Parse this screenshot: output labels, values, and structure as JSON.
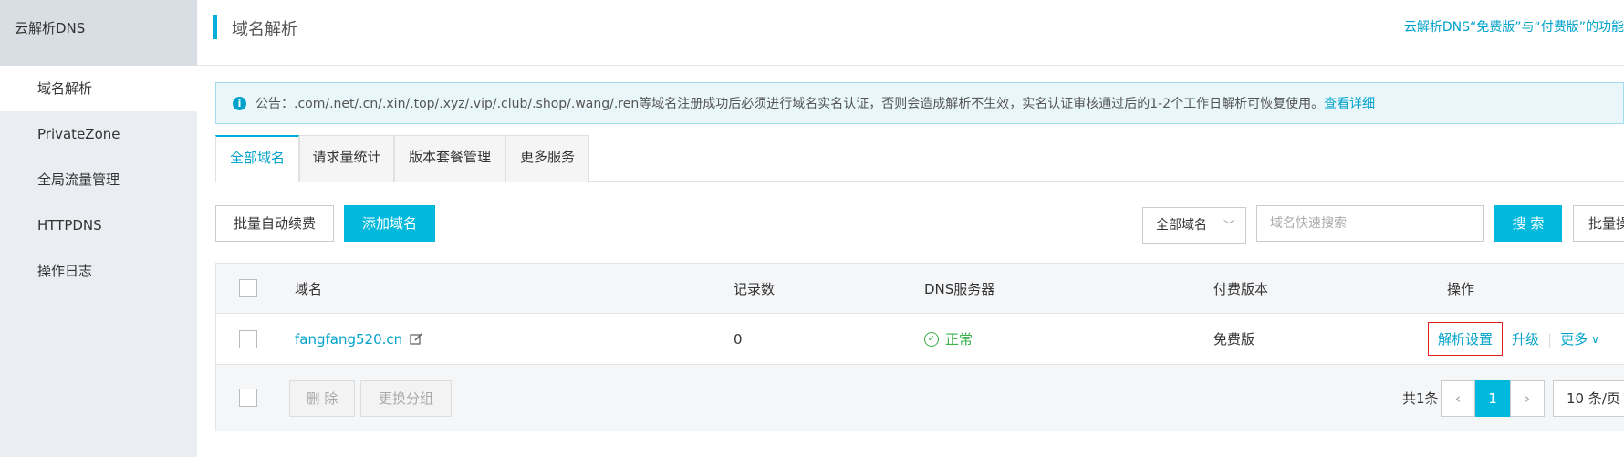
{
  "sidebar": {
    "title": "云解析DNS",
    "items": [
      {
        "label": "域名解析"
      },
      {
        "label": "PrivateZone"
      },
      {
        "label": "全局流量管理"
      },
      {
        "label": "HTTPDNS"
      },
      {
        "label": "操作日志"
      }
    ]
  },
  "header": {
    "title": "域名解析",
    "promo": "云解析DNS“免费版”与“付费版”的功能"
  },
  "notice": {
    "icon": "info-icon",
    "text": "公告：.com/.net/.cn/.xin/.top/.xyz/.vip/.club/.shop/.wang/.ren等域名注册成功后必须进行域名实名认证，否则会造成解析不生效，实名认证审核通过后的1-2个工作日解析可恢复使用。",
    "link": "查看详细"
  },
  "tabs": [
    {
      "label": "全部域名"
    },
    {
      "label": "请求量统计"
    },
    {
      "label": "版本套餐管理"
    },
    {
      "label": "更多服务"
    }
  ],
  "toolbar": {
    "renew_label": "批量自动续费",
    "add_label": "添加域名",
    "filter_value": "全部域名",
    "search_placeholder": "域名快速搜索",
    "search_label": "搜 索",
    "batch_label": "批量操"
  },
  "table": {
    "headers": {
      "domain": "域名",
      "records": "记录数",
      "dns": "DNS服务器",
      "version": "付费版本",
      "ops": "操作"
    },
    "rows": [
      {
        "domain": "fangfang520.cn",
        "records": "0",
        "dns_status": "正常",
        "version": "免费版",
        "op_settings": "解析设置",
        "op_upgrade": "升级",
        "op_more": "更多"
      }
    ]
  },
  "footer": {
    "delete_label": "删 除",
    "change_group_label": "更换分组",
    "total": "共1条",
    "current_page": "1",
    "page_size": "10 条/页"
  },
  "colors": {
    "accent": "#00b9dc",
    "link": "#00a2ca",
    "success": "#3cb04a",
    "highlight_box": "#e02020"
  }
}
